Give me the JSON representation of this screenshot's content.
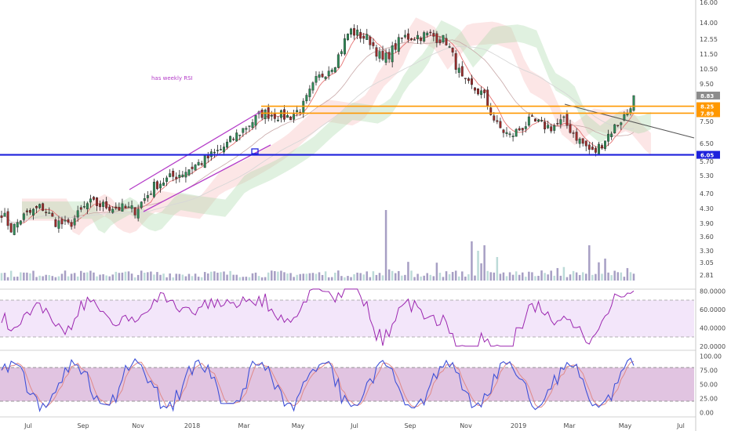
{
  "chart_data": {
    "type": "candlestick",
    "annotation": "has weekly RSI",
    "x_labels": [
      "Jul",
      "Sep",
      "Nov",
      "2018",
      "Mar",
      "May",
      "Jul",
      "Sep",
      "Nov",
      "2019",
      "Mar",
      "May",
      "Jul"
    ],
    "price_axis": {
      "scale": "log",
      "ticks": [
        "16.00",
        "14.00",
        "12.55",
        "11.50",
        "10.50",
        "9.50",
        "7.50",
        "6.50",
        "5.70",
        "5.30",
        "4.70",
        "4.30",
        "3.90",
        "3.60",
        "3.30",
        "3.05",
        "2.81"
      ]
    },
    "price_tags": [
      {
        "label": "8.83",
        "value": 8.83,
        "color": "#8c8c8c"
      },
      {
        "label": "8.25",
        "value": 8.25,
        "color": "#ff9800"
      },
      {
        "label": "7.89",
        "value": 7.89,
        "color": "#ff9800"
      },
      {
        "label": "6.05",
        "value": 6.05,
        "color": "#1e22dc"
      }
    ],
    "horizontal_levels": [
      {
        "value": 8.25,
        "color": "#ff9800"
      },
      {
        "value": 7.89,
        "color": "#ff9800"
      },
      {
        "value": 6.05,
        "color": "#1e22dc"
      }
    ],
    "price_anchors": [
      {
        "t": 0.0,
        "v": 4.2
      },
      {
        "t": 0.015,
        "v": 3.75
      },
      {
        "t": 0.03,
        "v": 4.05
      },
      {
        "t": 0.06,
        "v": 4.35
      },
      {
        "t": 0.08,
        "v": 3.95
      },
      {
        "t": 0.1,
        "v": 3.85
      },
      {
        "t": 0.13,
        "v": 4.45
      },
      {
        "t": 0.16,
        "v": 4.35
      },
      {
        "t": 0.2,
        "v": 4.25
      },
      {
        "t": 0.23,
        "v": 5.0
      },
      {
        "t": 0.27,
        "v": 5.4
      },
      {
        "t": 0.3,
        "v": 5.8
      },
      {
        "t": 0.33,
        "v": 6.3
      },
      {
        "t": 0.36,
        "v": 7.1
      },
      {
        "t": 0.39,
        "v": 7.9
      },
      {
        "t": 0.43,
        "v": 7.7
      },
      {
        "t": 0.45,
        "v": 8.2
      },
      {
        "t": 0.47,
        "v": 9.7
      },
      {
        "t": 0.5,
        "v": 11.0
      },
      {
        "t": 0.52,
        "v": 13.4
      },
      {
        "t": 0.55,
        "v": 12.6
      },
      {
        "t": 0.57,
        "v": 11.0
      },
      {
        "t": 0.6,
        "v": 12.8
      },
      {
        "t": 0.64,
        "v": 13.0
      },
      {
        "t": 0.665,
        "v": 12.5
      },
      {
        "t": 0.69,
        "v": 9.6
      },
      {
        "t": 0.72,
        "v": 8.9
      },
      {
        "t": 0.74,
        "v": 7.3
      },
      {
        "t": 0.76,
        "v": 6.8
      },
      {
        "t": 0.79,
        "v": 7.5
      },
      {
        "t": 0.82,
        "v": 7.2
      },
      {
        "t": 0.84,
        "v": 7.5
      },
      {
        "t": 0.865,
        "v": 6.6
      },
      {
        "t": 0.885,
        "v": 6.1
      },
      {
        "t": 0.91,
        "v": 7.0
      },
      {
        "t": 0.935,
        "v": 7.9
      },
      {
        "t": 0.945,
        "v": 8.83
      }
    ],
    "rsi": {
      "ticks": [
        "80.0000",
        "60.0000",
        "40.0000",
        "20.0000"
      ],
      "band": [
        30,
        70
      ],
      "color": "#9c27b0"
    },
    "stoch_rsi": {
      "ticks": [
        "100.00",
        "75.00",
        "50.00",
        "25.00",
        "0.00"
      ],
      "band": [
        20,
        80
      ],
      "k_color": "#3f51d8",
      "d_color": "#e08a8a"
    }
  }
}
